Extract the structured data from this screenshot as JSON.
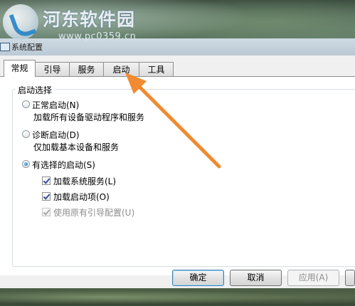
{
  "watermark": {
    "site_name": "河东软件园",
    "url": "www.pc0359.cn"
  },
  "window": {
    "title": "系统配置"
  },
  "tabs": [
    {
      "label": "常规",
      "active": true
    },
    {
      "label": "引导",
      "active": false
    },
    {
      "label": "服务",
      "active": false
    },
    {
      "label": "启动",
      "active": false
    },
    {
      "label": "工具",
      "active": false
    }
  ],
  "startup": {
    "group_label": "启动选择",
    "options": [
      {
        "label": "正常启动(N)",
        "desc": "加载所有设备驱动程序和服务",
        "selected": false
      },
      {
        "label": "诊断启动(D)",
        "desc": "仅加载基本设备和服务",
        "selected": false
      },
      {
        "label": "有选择的启动(S)",
        "selected": true
      }
    ],
    "selective": [
      {
        "label": "加载系统服务(L)",
        "checked": true,
        "enabled": true
      },
      {
        "label": "加载启动项(O)",
        "checked": true,
        "enabled": true
      },
      {
        "label": "使用原有引导配置(U)",
        "checked": true,
        "enabled": false
      }
    ]
  },
  "buttons": {
    "ok": "确定",
    "cancel": "取消",
    "apply": "应用(A)"
  },
  "colors": {
    "arrow": "#f28a30",
    "accent": "#1e6fb8"
  }
}
